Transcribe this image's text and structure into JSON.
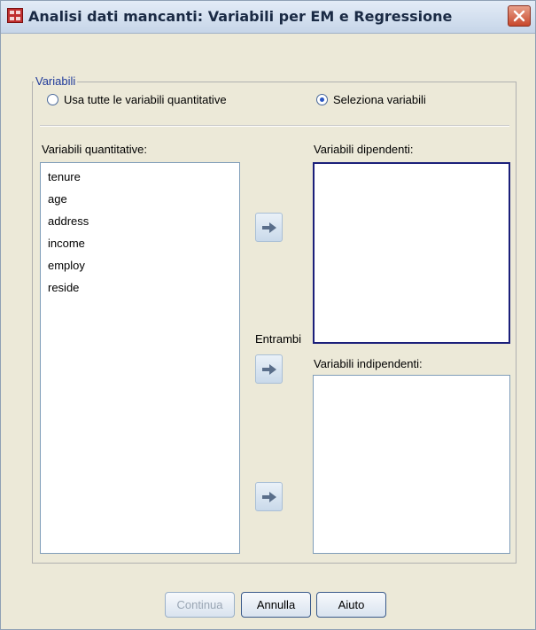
{
  "window": {
    "title": "Analisi dati mancanti: Variabili per EM e Regressione",
    "app_icon": "table-grid-icon",
    "close_icon": "close-icon"
  },
  "group": {
    "legend": "Variabili",
    "radio_all": {
      "label": "Usa tutte le variabili quantitative",
      "checked": false
    },
    "radio_select": {
      "label": "Seleziona variabili",
      "checked": true
    }
  },
  "quantitative": {
    "label": "Variabili quantitative:",
    "items": [
      "tenure",
      "age",
      "address",
      "income",
      "employ",
      "reside"
    ]
  },
  "dependent": {
    "label": "Variabili dipendenti:",
    "items": []
  },
  "independent": {
    "label": "Variabili indipendenti:",
    "items": []
  },
  "both_label": "Entrambi",
  "arrow_icon": "arrow-right-icon",
  "buttons": {
    "continue": "Continua",
    "cancel": "Annulla",
    "help": "Aiuto"
  },
  "colors": {
    "legend": "#1f3a9a",
    "dialog_bg": "#ece9d8",
    "selected_listbox_border": "#1b1f7a"
  }
}
